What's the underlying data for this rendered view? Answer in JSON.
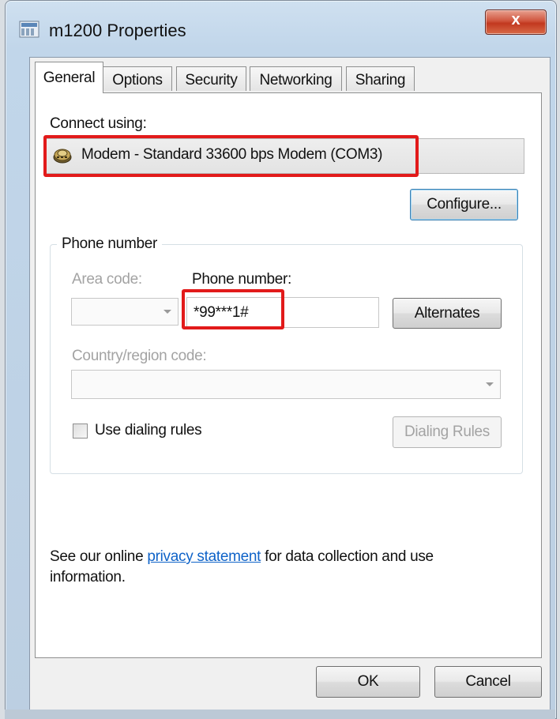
{
  "window": {
    "title": "m1200 Properties",
    "close_label": "x"
  },
  "tabs": [
    {
      "label": "General",
      "active": true
    },
    {
      "label": "Options",
      "active": false
    },
    {
      "label": "Security",
      "active": false
    },
    {
      "label": "Networking",
      "active": false
    },
    {
      "label": "Sharing",
      "active": false
    }
  ],
  "general": {
    "connect_using_label": "Connect using:",
    "device_name": "Modem - Standard 33600 bps Modem (COM3)",
    "configure_label": "Configure...",
    "phone_group_title": "Phone number",
    "area_code_label": "Area code:",
    "area_code_value": "",
    "phone_number_label": "Phone number:",
    "phone_number_value": "*99***1#",
    "alternates_label": "Alternates",
    "country_label": "Country/region code:",
    "country_value": "",
    "use_dialing_rules_label": "Use dialing rules",
    "use_dialing_rules_checked": false,
    "dialing_rules_label": "Dialing Rules",
    "privacy_prefix": "See our online",
    "privacy_link": "privacy statement",
    "privacy_suffix": "for data collection and use information."
  },
  "buttons": {
    "ok_label": "OK",
    "cancel_label": "Cancel"
  },
  "icons": {
    "window_icon": "network-connection-icon",
    "device_icon": "modem-icon",
    "close_icon": "close-icon"
  },
  "colors": {
    "highlight": "#e21a1a",
    "link": "#0f63c8",
    "close_button": "#c2381f"
  }
}
